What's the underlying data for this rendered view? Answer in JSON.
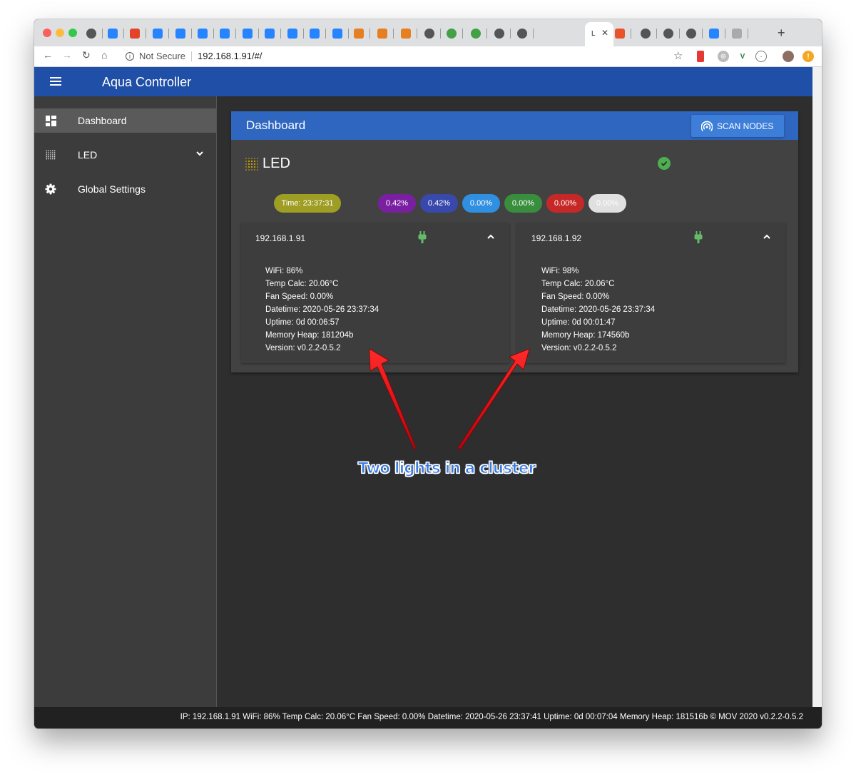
{
  "browser": {
    "tabs": [
      {
        "icon": "globe-icon"
      },
      {
        "icon": "bitbucket-icon"
      },
      {
        "icon": "gitlab-icon"
      },
      {
        "icon": "confluence-icon"
      },
      {
        "icon": "jira-icon"
      },
      {
        "icon": "jira-icon"
      },
      {
        "icon": "jira-icon"
      },
      {
        "icon": "jira-icon"
      },
      {
        "icon": "jira-icon"
      },
      {
        "icon": "jira-icon"
      },
      {
        "icon": "jira-icon"
      },
      {
        "icon": "jira-icon"
      },
      {
        "icon": "box-icon"
      },
      {
        "icon": "box-icon"
      },
      {
        "icon": "box-icon"
      },
      {
        "icon": "globe-icon"
      },
      {
        "icon": "green-globe-icon"
      },
      {
        "icon": "green-globe-icon"
      },
      {
        "icon": "globe-icon"
      },
      {
        "icon": "globe-icon"
      }
    ],
    "active_tab_label": "L",
    "new_tab_label": "+",
    "url_security": "Not Secure",
    "url": "192.168.1.91/#/"
  },
  "app": {
    "title": "Aqua Controller"
  },
  "drawer": {
    "items": [
      {
        "label": "Dashboard",
        "icon": "dashboard-icon",
        "active": true
      },
      {
        "label": "LED",
        "icon": "led-grid-icon",
        "expandable": true
      },
      {
        "label": "Global Settings",
        "icon": "gear-icon"
      }
    ]
  },
  "dashboard": {
    "title": "Dashboard",
    "scan_button": "SCAN NODES",
    "group": {
      "name": "LED",
      "status_icon": "check-circle-icon",
      "time_chip": "Time: 23:37:31",
      "channels": [
        {
          "value": "0.42%",
          "color": "#7b1fa2"
        },
        {
          "value": "0.42%",
          "color": "#3949ab"
        },
        {
          "value": "0.00%",
          "color": "#2f8fe0"
        },
        {
          "value": "0.00%",
          "color": "#388e3c"
        },
        {
          "value": "0.00%",
          "color": "#c62828"
        },
        {
          "value": "0.00%",
          "color": "#e0e0e0"
        }
      ],
      "time_chip_color": "#9e9d24",
      "nodes": [
        {
          "ip": "192.168.1.91",
          "lines": [
            "WiFi: 86%",
            "Temp Calc: 20.06°C",
            "Fan Speed: 0.00%",
            "Datetime: 2020-05-26 23:37:34",
            "Uptime: 0d 00:06:57",
            "Memory Heap: 181204b",
            "Version: v0.2.2-0.5.2"
          ]
        },
        {
          "ip": "192.168.1.92",
          "lines": [
            "WiFi: 98%",
            "Temp Calc: 20.06°C",
            "Fan Speed: 0.00%",
            "Datetime: 2020-05-26 23:37:34",
            "Uptime: 0d 00:01:47",
            "Memory Heap: 174560b",
            "Version: v0.2.2-0.5.2"
          ]
        }
      ]
    }
  },
  "footer": {
    "text": "IP: 192.168.1.91 WiFi: 86% Temp Calc: 20.06°C Fan Speed: 0.00% Datetime: 2020-05-26 23:37:41 Uptime: 0d 00:07:04 Memory Heap: 181516b © MOV 2020 v0.2.2-0.5.2"
  },
  "annotation": {
    "text": "Two lights in a cluster",
    "arrow_color": "#e8141b"
  }
}
